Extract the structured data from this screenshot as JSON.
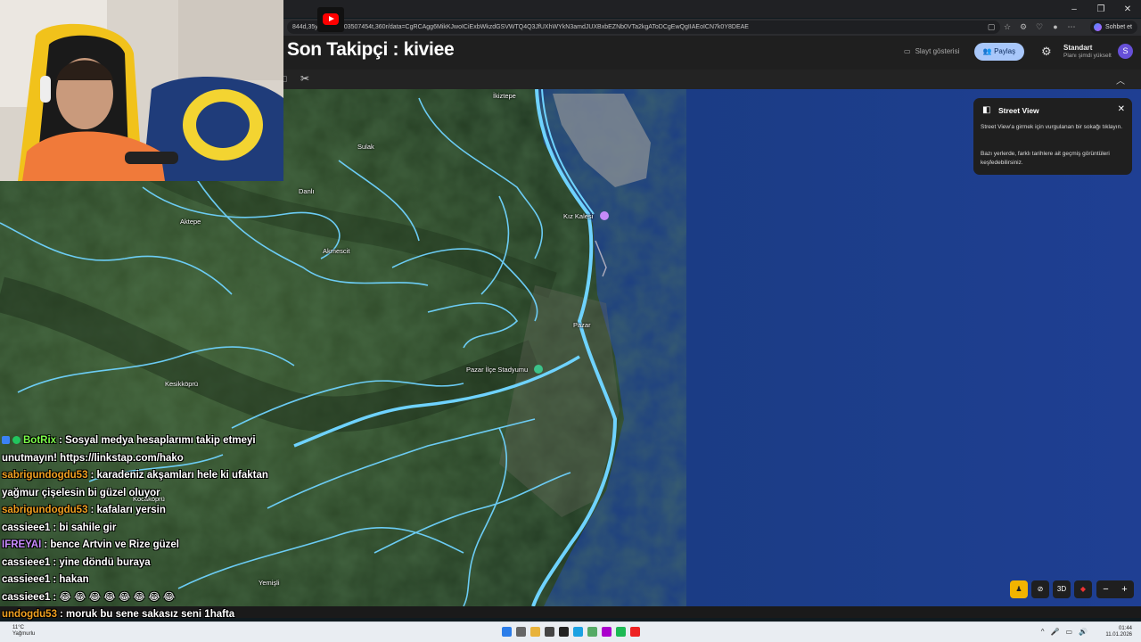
{
  "browser": {
    "url": "844d,35y,-85.1h,1.03507454t,360r/data=CgRCAgg6MikKJwoICiExbWkzdGSVWTQ4Q3JfUXhWYkN3amdJUXBxbEZNb0VTa2kgAToDCgEwQgIIAEoICN7k0Y8DEAE",
    "chat_button": "Sohbet et",
    "window_controls": [
      "–",
      "❐",
      "✕"
    ]
  },
  "overlay": {
    "follower_text": "Son Takipçi : kiviee"
  },
  "maps": {
    "slideshow_label": "Slayt gösterisi",
    "share_label": "Paylaş",
    "plan_title": "Standart",
    "plan_subtitle": "Planı şimdi yükselt",
    "avatar_letter": "S",
    "places": [
      {
        "name": "İkiztepe"
      },
      {
        "name": "Sulak"
      },
      {
        "name": "Danlı"
      },
      {
        "name": "Aktepe"
      },
      {
        "name": "Akmescit"
      },
      {
        "name": "Kız Kalesi"
      },
      {
        "name": "Pazar"
      },
      {
        "name": "Pazar İlçe Stadyumu"
      },
      {
        "name": "Kesikköprü"
      },
      {
        "name": "Kocaköprü"
      },
      {
        "name": "Yemişli"
      }
    ],
    "street_view": {
      "title": "Street View",
      "text1": "Street View'a girmek için vurgulanan bir sokağı tıklayın.",
      "text2": "Bazı yerlerde, farklı tarihlere ait geçmiş görüntüleri keşfedebilirsiniz."
    },
    "controls": {
      "view_3d": "3D",
      "zoom_out": "−",
      "zoom_in": "+"
    }
  },
  "chat": [
    {
      "user": "BotRix",
      "color": "#7dff4a",
      "text": ": Sosyal medya hesaplarımı takip etmeyi",
      "badges": true
    },
    {
      "user": "",
      "color": "#ffffff",
      "text": "unutmayın! https://linkstap.com/hako",
      "badges": false
    },
    {
      "user": "sabrigundogdu53",
      "color": "#f0a020",
      "text": ": karadeniz akşamları hele ki ufaktan",
      "badges": false
    },
    {
      "user": "",
      "color": "#ffffff",
      "text": "yağmur çişelesin bi güzel oluyor",
      "badges": false
    },
    {
      "user": "sabrigundogdu53",
      "color": "#f0a020",
      "text": ": kafaları yersin",
      "badges": false
    },
    {
      "user": "cassieee1",
      "color": "#ffffff",
      "text": ": bi sahile gir",
      "badges": false
    },
    {
      "user": "IFREYAI",
      "color": "#c88cff",
      "text": ": bence Artvin ve Rize güzel",
      "badges": false
    },
    {
      "user": "cassieee1",
      "color": "#ffffff",
      "text": ": yine döndü buraya",
      "badges": false
    },
    {
      "user": "cassieee1",
      "color": "#ffffff",
      "text": ": hakan",
      "badges": false
    },
    {
      "user": "cassieee1",
      "color": "#ffffff",
      "text": ": 😂 😂 😂 😂 😂 😂 😂 😂",
      "badges": false
    },
    {
      "user": "undogdu53",
      "color": "#f0a020",
      "text": ": moruk bu sene sakasız seni 1hafta",
      "badges": false
    }
  ],
  "taskbar": {
    "temp": "11°C",
    "condition": "Yağmurlu",
    "time": "01:44",
    "date": "11.01.2026"
  },
  "colors": {
    "sea": "#1c3a8c",
    "land": "#2c4a2a",
    "road": "#6fd3ff",
    "accent": "#a8c7fa"
  }
}
